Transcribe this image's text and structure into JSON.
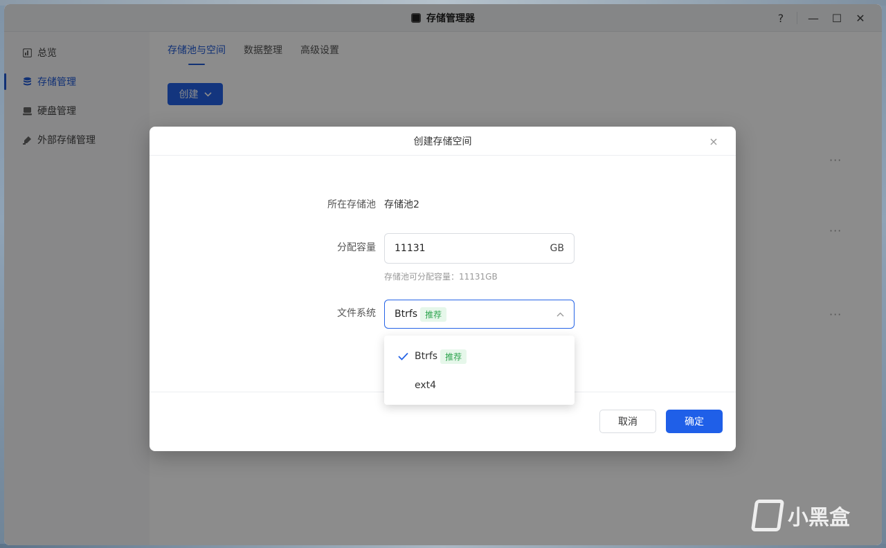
{
  "window": {
    "title": "存储管理器"
  },
  "window_controls": {
    "help": "?",
    "minimize": "—",
    "maximize": "☐",
    "close": "✕"
  },
  "sidebar": {
    "items": [
      {
        "label": "总览",
        "icon": "chart-icon"
      },
      {
        "label": "存储管理",
        "icon": "database-icon",
        "active": true
      },
      {
        "label": "硬盘管理",
        "icon": "disk-icon"
      },
      {
        "label": "外部存储管理",
        "icon": "usb-icon"
      }
    ]
  },
  "main": {
    "tabs": [
      {
        "label": "存储池与空间",
        "active": true
      },
      {
        "label": "数据整理"
      },
      {
        "label": "高级设置"
      }
    ],
    "create_button": "创建",
    "more_dots": "···"
  },
  "dialog": {
    "title": "创建存储空间",
    "close": "×",
    "fields": {
      "pool_label": "所在存储池",
      "pool_value": "存储池2",
      "capacity_label": "分配容量",
      "capacity_value": "11131",
      "capacity_unit": "GB",
      "capacity_hint": "存储池可分配容量：11131GB",
      "fs_label": "文件系统",
      "fs_value": "Btrfs",
      "fs_tag": "推荐"
    },
    "dropdown": {
      "options": [
        {
          "label": "Btrfs",
          "tag": "推荐",
          "selected": true
        },
        {
          "label": "ext4"
        }
      ]
    },
    "cancel_button": "取消",
    "ok_button": "确定"
  },
  "watermark": {
    "text": "小黑盒"
  },
  "colors": {
    "accent": "#2362e6",
    "tag_green": "#2da44e",
    "tag_bg": "#e6f7ea"
  }
}
